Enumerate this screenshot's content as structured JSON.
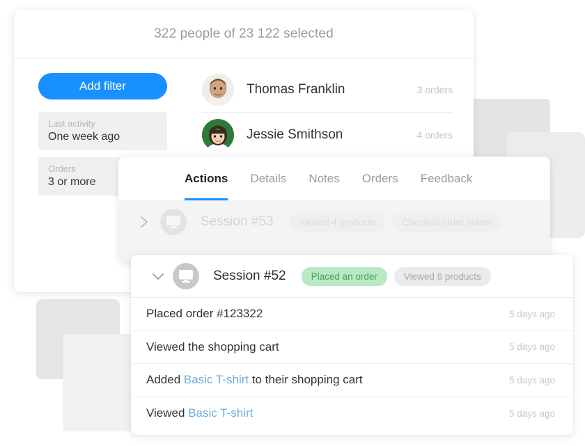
{
  "people_card": {
    "header_title": "322 people of 23 122 selected",
    "add_filter_label": "Add filter",
    "filters": [
      {
        "label": "Last activity",
        "value": "One week ago"
      },
      {
        "label": "Orders",
        "value": "3 or more"
      }
    ],
    "people": [
      {
        "name": "Thomas Franklin",
        "orders": "3  orders",
        "avatar": "man-avatar"
      },
      {
        "name": "Jessie Smithson",
        "orders": "4 orders",
        "avatar": "woman-avatar"
      }
    ]
  },
  "actions_panel": {
    "tabs": [
      {
        "label": "Actions",
        "active": true
      },
      {
        "label": "Details",
        "active": false
      },
      {
        "label": "Notes",
        "active": false
      },
      {
        "label": "Orders",
        "active": false
      },
      {
        "label": "Feedback",
        "active": false
      }
    ],
    "collapsed_session": {
      "title": "Session #53",
      "icon": "desktop-icon",
      "chevron": "chevron-right-icon",
      "badges": [
        {
          "text": "Viewed 4 products",
          "style": "grey"
        },
        {
          "text": "Checked order status",
          "style": "grey"
        }
      ]
    }
  },
  "detail_card": {
    "expanded_session": {
      "title": "Session #52",
      "icon": "desktop-icon",
      "chevron": "chevron-down-icon",
      "badges": [
        {
          "text": "Placed an order",
          "style": "green"
        },
        {
          "text": "Viewed 8 products",
          "style": "grey"
        }
      ]
    },
    "activities": [
      {
        "prefix": "Placed order #123322",
        "link": "",
        "suffix": "",
        "time": "5 days ago"
      },
      {
        "prefix": "Viewed the shopping cart",
        "link": "",
        "suffix": "",
        "time": "5 days ago"
      },
      {
        "prefix": "Added ",
        "link": "Basic T-shirt",
        "suffix": " to their shopping cart",
        "time": "5 days ago"
      },
      {
        "prefix": "Viewed ",
        "link": "Basic T-shirt",
        "suffix": "",
        "time": "5 days ago"
      }
    ]
  },
  "colors": {
    "accent_blue": "#1890ff",
    "badge_green_bg": "#b9e8c4",
    "badge_green_text": "#4b9c62",
    "link_blue": "#6aaee0",
    "muted_text": "#9a9a9a"
  }
}
